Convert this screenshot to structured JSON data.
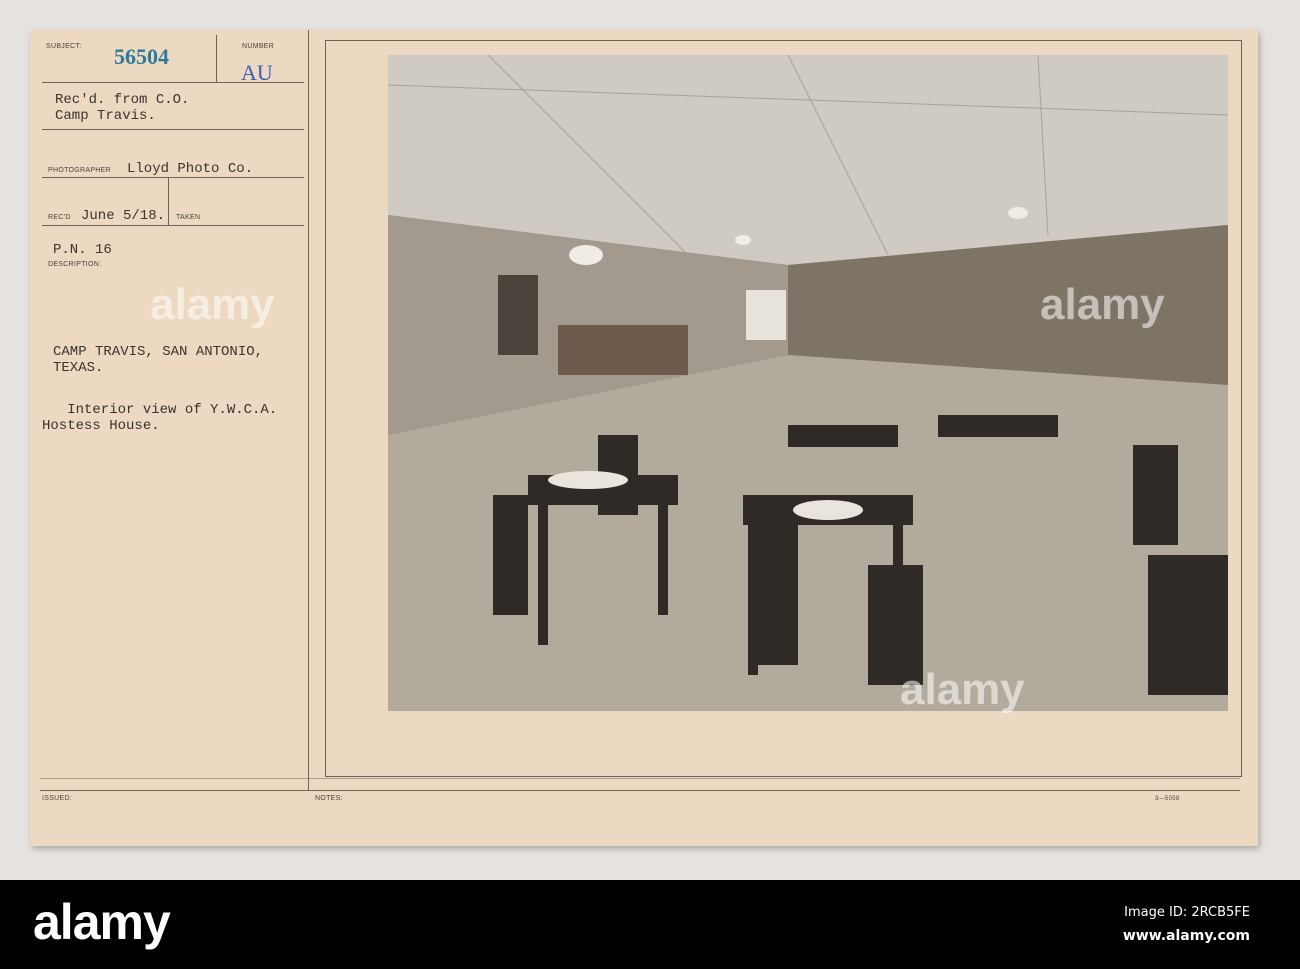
{
  "card": {
    "subject_label": "SUBJECT:",
    "subject_number": "56504",
    "number_label": "NUMBER",
    "number_value": "AU",
    "received_from": "Rec'd. from C.O.\nCamp Travis.",
    "photographer_label": "PHOTOGRAPHER",
    "photographer": "Lloyd Photo Co.",
    "recd_label": "REC'D",
    "recd_date": "June 5/18.",
    "taken_label": "TAKEN",
    "pn": "P.N. 16",
    "description_label": "DESCRIPTION:",
    "location": "CAMP TRAVIS, SAN ANTONIO,\nTEXAS.",
    "description": "   Interior view of Y.W.C.A.\nHostess House.",
    "issued_label": "ISSUED:",
    "notes_label": "NOTES:",
    "form_code": "3—5058",
    "stamp_color": "#2d7a9a",
    "number_color": "#3d5fb5"
  },
  "watermark": "alamy",
  "footer": {
    "logo": "alamy",
    "image_id": "Image ID: 2RCB5FE",
    "url": "www.alamy.com"
  }
}
